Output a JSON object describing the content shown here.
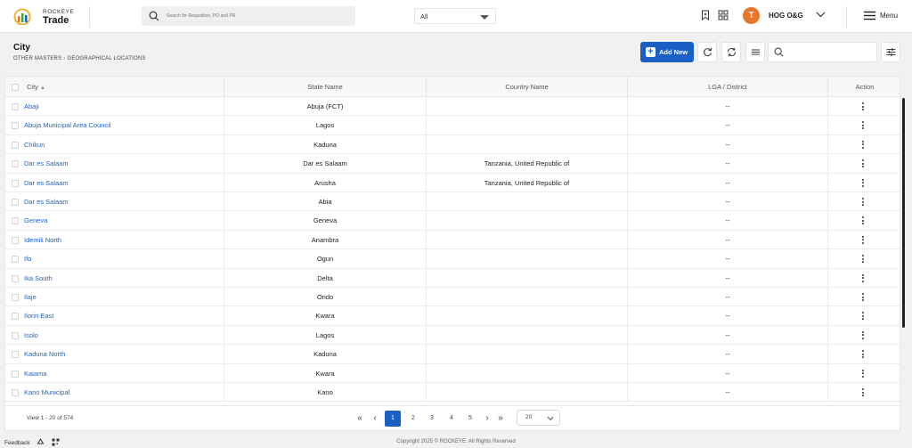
{
  "brand": {
    "small": "ROCKEYE",
    "name": "Trade"
  },
  "search": {
    "placeholder": "Search for Requisition, PO and PR",
    "scope": "All"
  },
  "user": {
    "initial": "T",
    "name": "HOG O&G"
  },
  "menu_label": "Menu",
  "page": {
    "title": "City",
    "breadcrumb": [
      "OTHER MASTERS",
      "GEOGRAPHICAL LOCATIONS"
    ],
    "add_new_label": "Add New"
  },
  "table": {
    "columns": [
      "City",
      "State Name",
      "Country Name",
      "LGA / District",
      "Action"
    ],
    "rows": [
      {
        "city": "Abaji",
        "state": "Abuja (FCT)",
        "country": "",
        "lga": "--"
      },
      {
        "city": "Abuja Municipal Area Council",
        "state": "Lagos",
        "country": "",
        "lga": "--"
      },
      {
        "city": "Chikun",
        "state": "Kaduna",
        "country": "",
        "lga": "--"
      },
      {
        "city": "Dar es Salaam",
        "state": "Dar es Salaam",
        "country": "Tanzania, United Republic of",
        "lga": "--"
      },
      {
        "city": "Dar es Salaam",
        "state": "Arusha",
        "country": "Tanzania, United Republic of",
        "lga": "--"
      },
      {
        "city": "Dar es Salaam",
        "state": "Abia",
        "country": "",
        "lga": "--"
      },
      {
        "city": "Geneva",
        "state": "Geneva",
        "country": "",
        "lga": "--"
      },
      {
        "city": "Idemili North",
        "state": "Anambra",
        "country": "",
        "lga": "--"
      },
      {
        "city": "Ifo",
        "state": "Ogun",
        "country": "",
        "lga": "--"
      },
      {
        "city": "Ika South",
        "state": "Delta",
        "country": "",
        "lga": "--"
      },
      {
        "city": "Ilaje",
        "state": "Ondo",
        "country": "",
        "lga": "--"
      },
      {
        "city": "Ilorin East",
        "state": "Kwara",
        "country": "",
        "lga": "--"
      },
      {
        "city": "Isolo",
        "state": "Lagos",
        "country": "",
        "lga": "--"
      },
      {
        "city": "Kaduna North",
        "state": "Kaduna",
        "country": "",
        "lga": "--"
      },
      {
        "city": "Kaiama",
        "state": "Kwara",
        "country": "",
        "lga": "--"
      },
      {
        "city": "Kano Municipal",
        "state": "Kano",
        "country": "",
        "lga": "--"
      }
    ]
  },
  "pagination": {
    "view_text": "View 1 - 20 of 574",
    "pages": [
      "1",
      "2",
      "3",
      "4",
      "5"
    ],
    "current_page": "1",
    "page_size": "20"
  },
  "footer": {
    "feedback_label": "Feedback",
    "copyright": "Copyright 2025 © ROCKEYE. All Rights Reserved"
  },
  "colors": {
    "accent": "#1a5fc4",
    "link": "#1f63c6",
    "avatar": "#e8762a"
  },
  "icons": [
    "search-icon",
    "chevron-down-icon",
    "bookmark-icon",
    "apps-grid-icon",
    "hamburger-icon",
    "plus-icon",
    "refresh-icon",
    "sync-icon",
    "list-icon",
    "filter-sliders-icon",
    "kebab-icon",
    "recycle-icon",
    "qr-icon"
  ]
}
